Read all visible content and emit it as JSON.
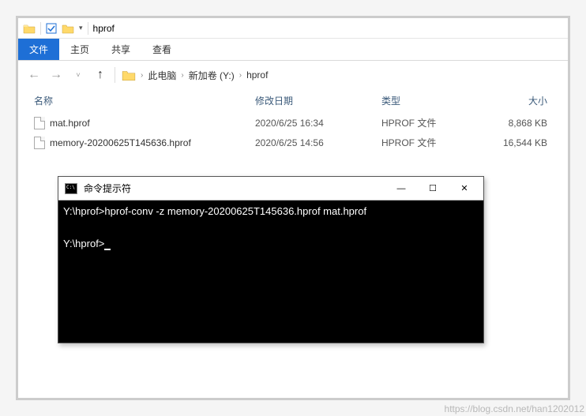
{
  "titlebar": {
    "folder_name": "hprof"
  },
  "ribbon": {
    "file": "文件",
    "home": "主页",
    "share": "共享",
    "view": "查看"
  },
  "breadcrumb": {
    "root": "此电脑",
    "drive": "新加卷 (Y:)",
    "folder": "hprof"
  },
  "columns": {
    "name": "名称",
    "date": "修改日期",
    "type": "类型",
    "size": "大小"
  },
  "files": [
    {
      "name": "mat.hprof",
      "date": "2020/6/25 16:34",
      "type": "HPROF 文件",
      "size": "8,868 KB"
    },
    {
      "name": "memory-20200625T145636.hprof",
      "date": "2020/6/25 14:56",
      "type": "HPROF 文件",
      "size": "16,544 KB"
    }
  ],
  "cmd": {
    "title": "命令提示符",
    "line1": "Y:\\hprof>hprof-conv -z memory-20200625T145636.hprof mat.hprof",
    "line2": "Y:\\hprof>"
  },
  "watermark": "https://blog.csdn.net/han1202012"
}
